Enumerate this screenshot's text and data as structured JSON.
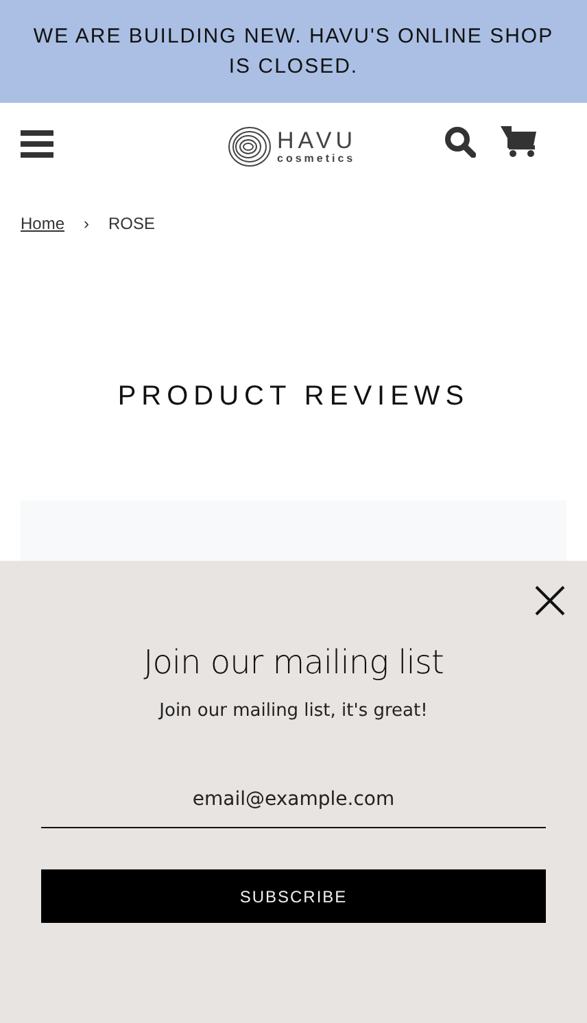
{
  "announcement": "WE ARE BUILDING NEW. HAVU'S ONLINE SHOP IS CLOSED.",
  "logo": {
    "name": "HAVU",
    "tagline": "cosmetics"
  },
  "breadcrumb": [
    {
      "label": "Home",
      "kind": "link"
    },
    {
      "label": "›",
      "kind": "separator"
    },
    {
      "label": "ROSE",
      "kind": "current"
    }
  ],
  "page_title": "PRODUCT REVIEWS",
  "popup": {
    "title": "Join our mailing list",
    "subtitle": "Join our mailing list, it's great!",
    "email_placeholder": "email@example.com",
    "button": "SUBSCRIBE"
  }
}
